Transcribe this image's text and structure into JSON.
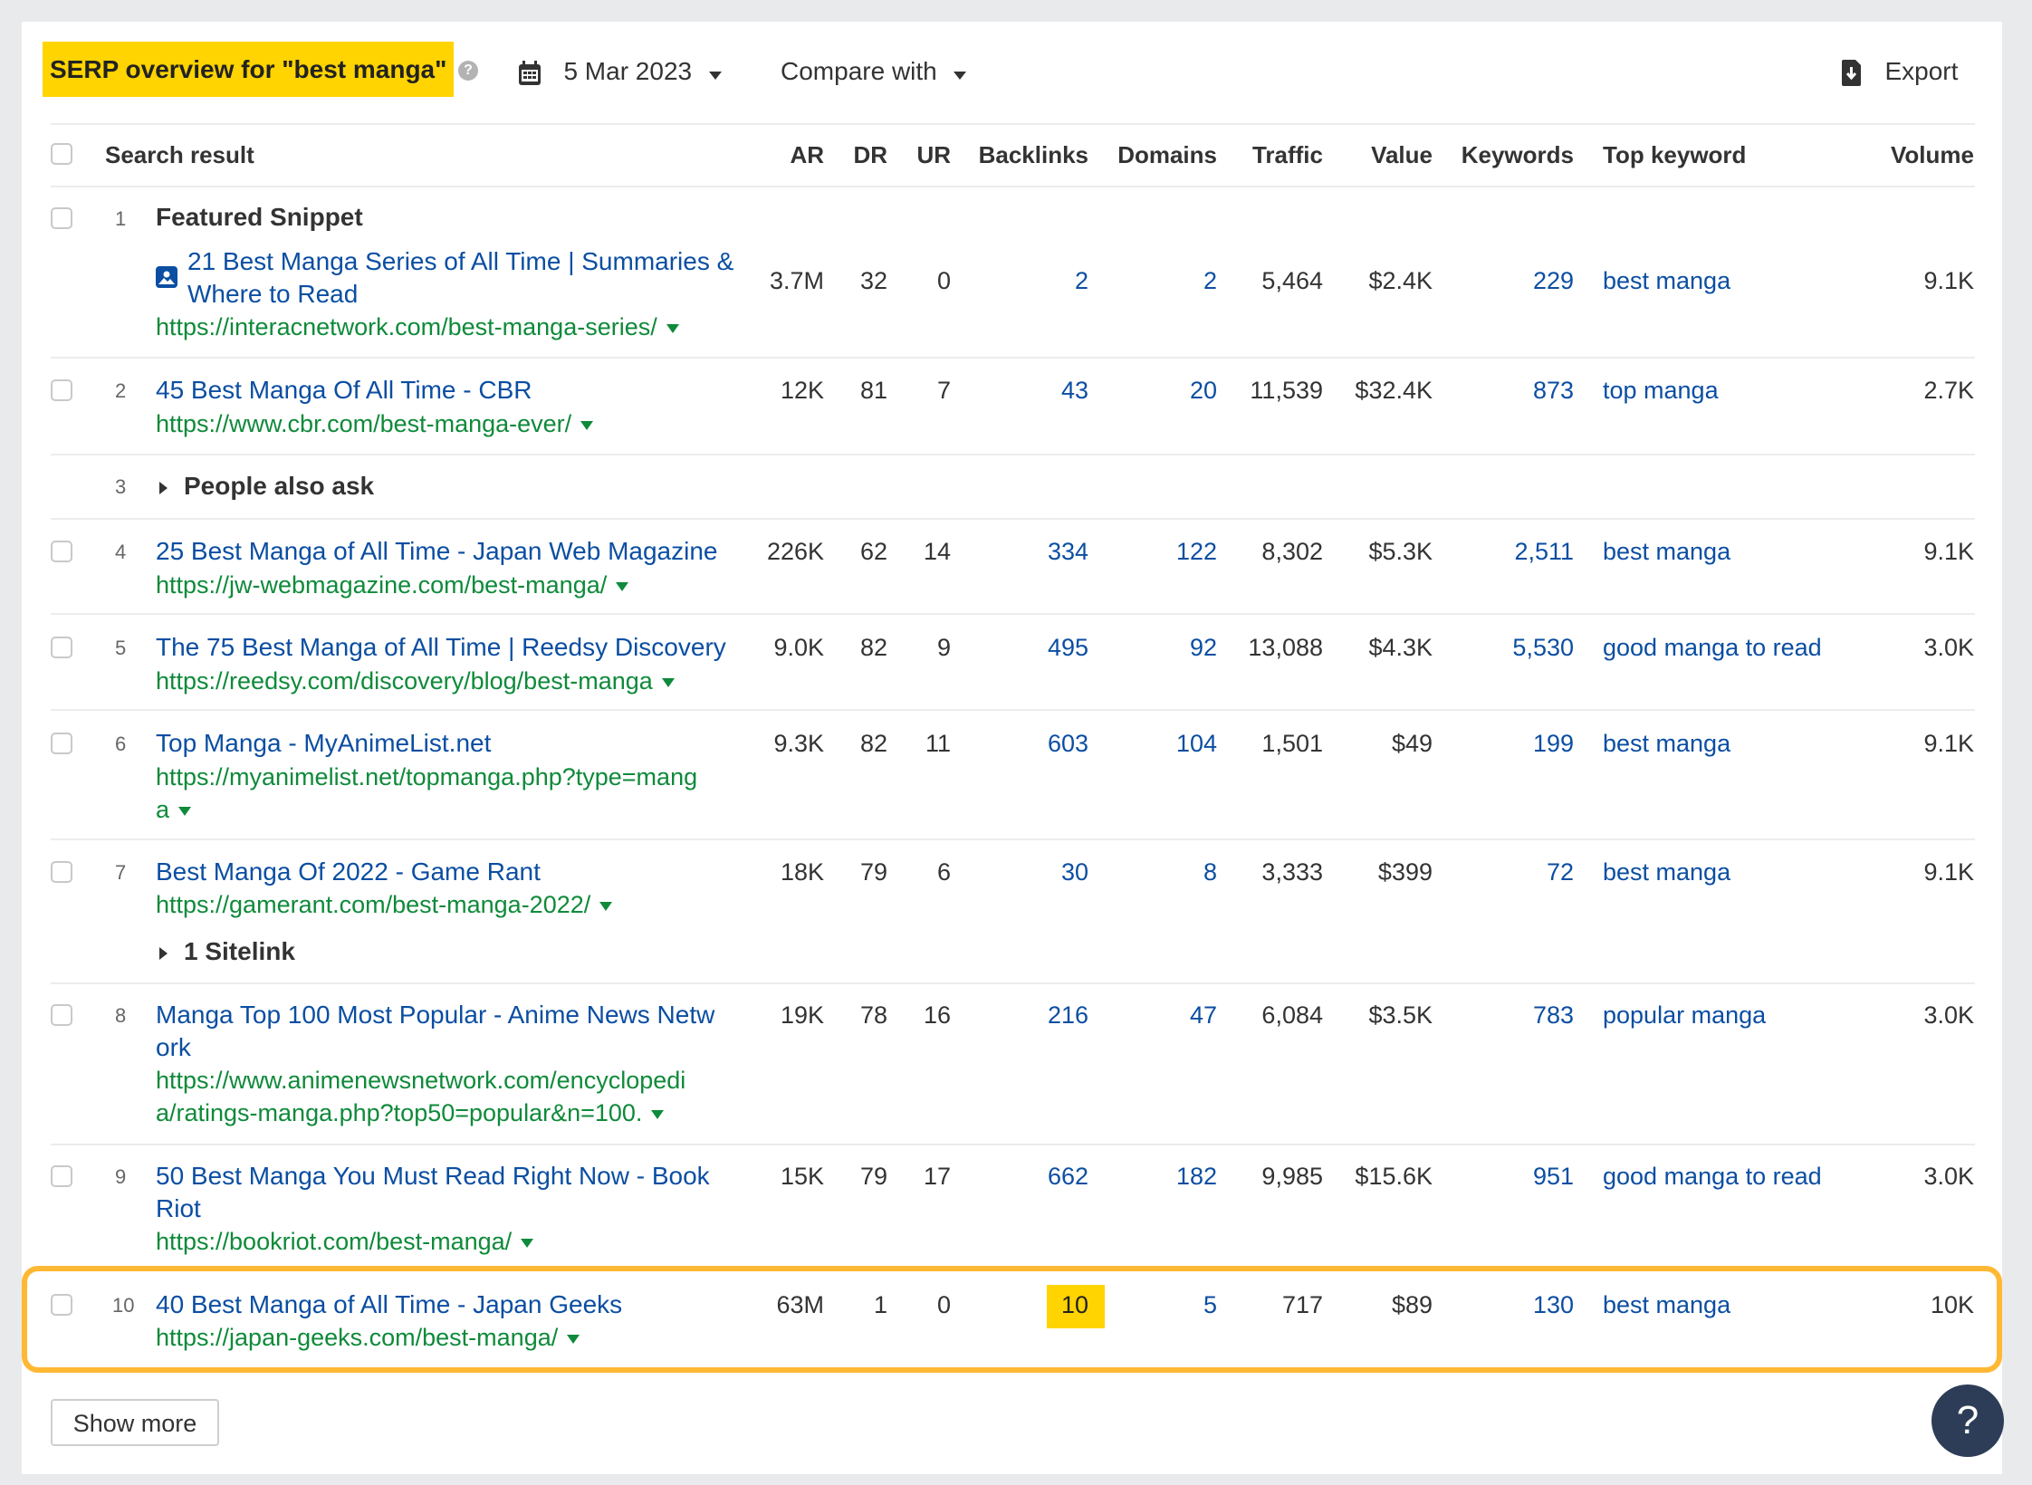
{
  "header": {
    "title": "SERP overview for \"best manga\"",
    "help_glyph": "?",
    "date": "5 Mar 2023",
    "compare_label": "Compare with",
    "export_label": "Export"
  },
  "columns": {
    "search_result": "Search result",
    "ar": "AR",
    "dr": "DR",
    "ur": "UR",
    "backlinks": "Backlinks",
    "domains": "Domains",
    "traffic": "Traffic",
    "value": "Value",
    "keywords": "Keywords",
    "top_keyword": "Top keyword",
    "volume": "Volume"
  },
  "rows": [
    {
      "pos": "1",
      "label": "Featured Snippet",
      "title_line1": "21 Best Manga Series of All Time | Summaries &",
      "title_line2": "Where to Read",
      "url": "https://interacnetwork.com/best-manga-series/",
      "ar": "3.7M",
      "dr": "32",
      "ur": "0",
      "backlinks": "2",
      "domains": "2",
      "traffic": "5,464",
      "value": "$2.4K",
      "keywords": "229",
      "top_keyword": "best manga",
      "volume": "9.1K"
    },
    {
      "pos": "2",
      "title_line1": "45 Best Manga Of All Time - CBR",
      "url": "https://www.cbr.com/best-manga-ever/",
      "ar": "12K",
      "dr": "81",
      "ur": "7",
      "backlinks": "43",
      "domains": "20",
      "traffic": "11,539",
      "value": "$32.4K",
      "keywords": "873",
      "top_keyword": "top manga",
      "volume": "2.7K"
    },
    {
      "pos": "3",
      "label": "People also ask"
    },
    {
      "pos": "4",
      "title_line1": "25 Best Manga of All Time - Japan Web Magazine",
      "url": "https://jw-webmagazine.com/best-manga/",
      "ar": "226K",
      "dr": "62",
      "ur": "14",
      "backlinks": "334",
      "domains": "122",
      "traffic": "8,302",
      "value": "$5.3K",
      "keywords": "2,511",
      "top_keyword": "best manga",
      "volume": "9.1K"
    },
    {
      "pos": "5",
      "title_line1": "The 75 Best Manga of All Time | Reedsy Discovery",
      "url": "https://reedsy.com/discovery/blog/best-manga",
      "ar": "9.0K",
      "dr": "82",
      "ur": "9",
      "backlinks": "495",
      "domains": "92",
      "traffic": "13,088",
      "value": "$4.3K",
      "keywords": "5,530",
      "top_keyword": "good manga to read",
      "volume": "3.0K"
    },
    {
      "pos": "6",
      "title_line1": "Top Manga - MyAnimeList.net",
      "url_line1": "https://myanimelist.net/topmanga.php?type=mang",
      "url_line2": "a",
      "ar": "9.3K",
      "dr": "82",
      "ur": "11",
      "backlinks": "603",
      "domains": "104",
      "traffic": "1,501",
      "value": "$49",
      "keywords": "199",
      "top_keyword": "best manga",
      "volume": "9.1K"
    },
    {
      "pos": "7",
      "title_line1": "Best Manga Of 2022 - Game Rant",
      "url": "https://gamerant.com/best-manga-2022/",
      "sitelink": "1 Sitelink",
      "ar": "18K",
      "dr": "79",
      "ur": "6",
      "backlinks": "30",
      "domains": "8",
      "traffic": "3,333",
      "value": "$399",
      "keywords": "72",
      "top_keyword": "best manga",
      "volume": "9.1K"
    },
    {
      "pos": "8",
      "title_line1": "Manga Top 100 Most Popular - Anime News Netw",
      "title_line2": "ork",
      "url_line1": "https://www.animenewsnetwork.com/encyclopedi",
      "url_line2": "a/ratings-manga.php?top50=popular&n=100.",
      "ar": "19K",
      "dr": "78",
      "ur": "16",
      "backlinks": "216",
      "domains": "47",
      "traffic": "6,084",
      "value": "$3.5K",
      "keywords": "783",
      "top_keyword": "popular manga",
      "volume": "3.0K"
    },
    {
      "pos": "9",
      "title_line1": "50 Best Manga You Must Read Right Now - Book",
      "title_line2": "Riot",
      "url": "https://bookriot.com/best-manga/",
      "ar": "15K",
      "dr": "79",
      "ur": "17",
      "backlinks": "662",
      "domains": "182",
      "traffic": "9,985",
      "value": "$15.6K",
      "keywords": "951",
      "top_keyword": "good manga to read",
      "volume": "3.0K"
    },
    {
      "pos": "10",
      "title_line1": "40 Best Manga of All Time - Japan Geeks",
      "url": "https://japan-geeks.com/best-manga/",
      "ar": "63M",
      "dr": "1",
      "ur": "0",
      "backlinks": "10",
      "domains": "5",
      "traffic": "717",
      "value": "$89",
      "keywords": "130",
      "top_keyword": "best manga",
      "volume": "10K",
      "highlighted": true
    }
  ],
  "footer": {
    "show_more_label": "Show more",
    "help_button_glyph": "?"
  },
  "colors": {
    "highlight_yellow": "#ffd400",
    "highlight_border": "#ffb833",
    "link_blue": "#0b4ea2",
    "url_green": "#0f8a3a",
    "help_button_bg": "#2e3d57"
  }
}
